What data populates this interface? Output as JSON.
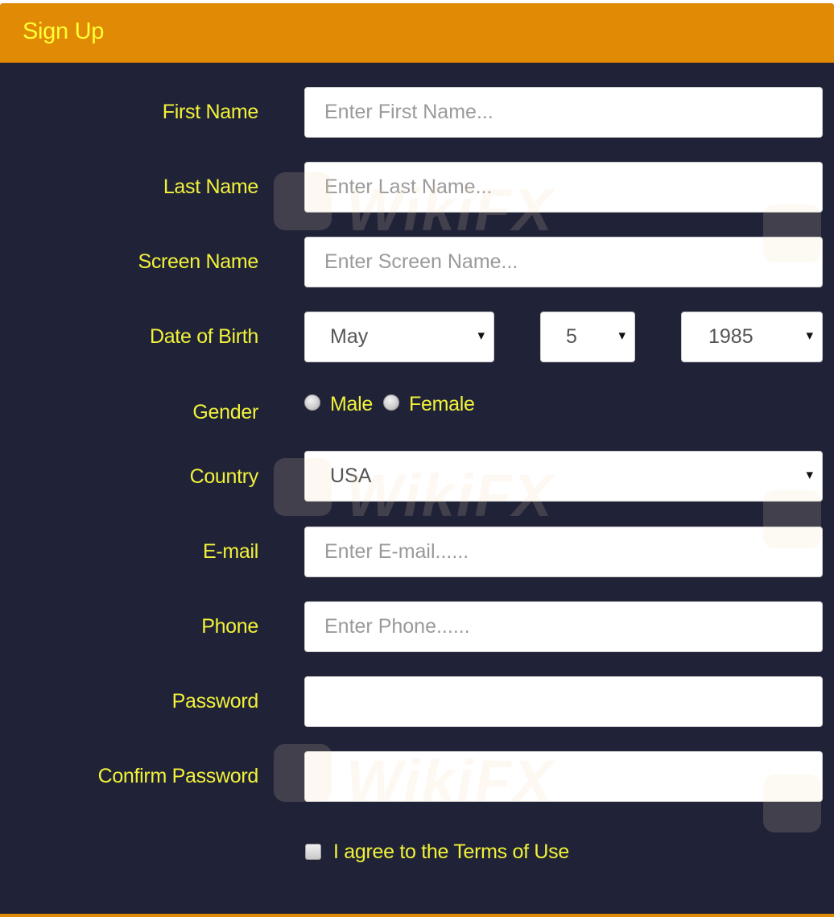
{
  "header": {
    "title": "Sign Up"
  },
  "form": {
    "first_name": {
      "label": "First Name",
      "placeholder": "Enter First Name..."
    },
    "last_name": {
      "label": "Last Name",
      "placeholder": "Enter Last Name..."
    },
    "screen_name": {
      "label": "Screen Name",
      "placeholder": "Enter Screen Name..."
    },
    "dob": {
      "label": "Date of Birth",
      "month": "May",
      "day": "5",
      "year": "1985",
      "arrow": "▾"
    },
    "gender": {
      "label": "Gender",
      "options": [
        "Male",
        "Female"
      ]
    },
    "country": {
      "label": "Country",
      "value": "USA"
    },
    "email": {
      "label": "E-mail",
      "placeholder": "Enter E-mail......"
    },
    "phone": {
      "label": "Phone",
      "placeholder": "Enter Phone......"
    },
    "password": {
      "label": "Password",
      "placeholder": ""
    },
    "confirm_password": {
      "label": "Confirm Password",
      "placeholder": ""
    },
    "terms": {
      "label": "I agree to the Terms of Use"
    }
  },
  "watermark": {
    "text": "WikiFX"
  },
  "colors": {
    "header_bg": "#e08a06",
    "panel_bg": "#202338",
    "label_text": "#f2f23a"
  }
}
